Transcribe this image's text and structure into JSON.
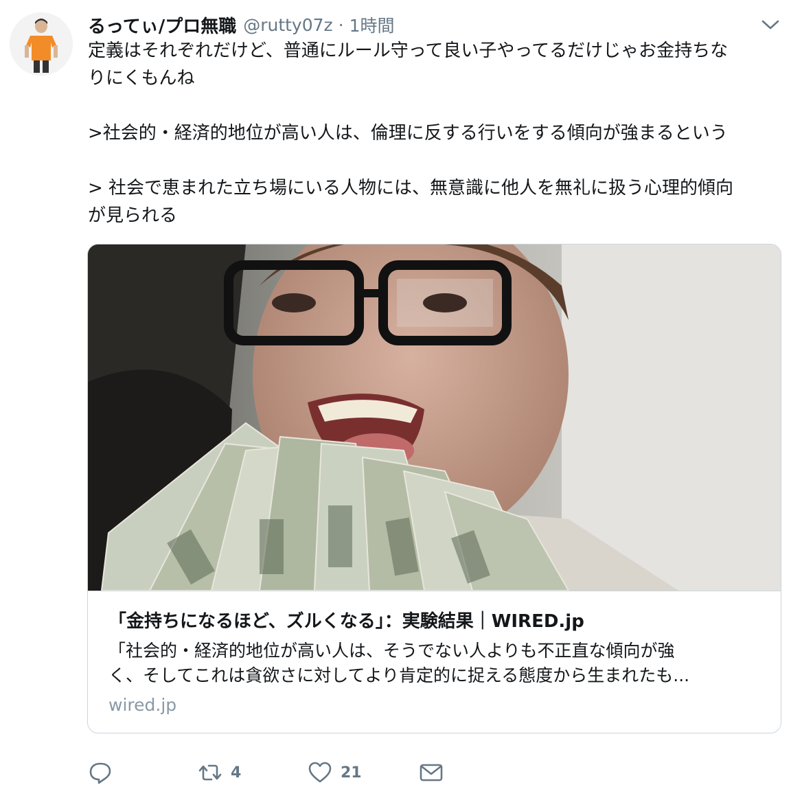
{
  "tweet": {
    "display_name": "るってぃ/プロ無職",
    "handle": "@rutty07z",
    "separator": "·",
    "time": "1時間",
    "lines": [
      "定義はそれぞれだけど、普通にルール守って良い子やってるだけじゃお金持ちな",
      "りにくもんね",
      "",
      ">社会的・経済的地位が高い人は、倫理に反する行いをする傾向が強まるという",
      "",
      "> 社会で恵まれた立ち場にいる人物には、無意識に他人を無礼に扱う心理的傾向",
      "が見られる"
    ]
  },
  "card": {
    "title": "「金持ちになるほど、ズルくなる」：実験結果｜WIRED.jp",
    "description_line1": "「社会的・経済的地位が高い人は、そうでない人よりも不正直な傾向が強",
    "description_line2": "く、そしてこれは貪欲さに対してより肯定的に捉える態度から生まれたも...",
    "domain": "wired.jp"
  },
  "actions": {
    "reply_icon": "reply-icon",
    "retweet_icon": "retweet-icon",
    "retweet_count": "4",
    "like_icon": "heart-icon",
    "like_count": "21",
    "dm_icon": "envelope-icon"
  },
  "colors": {
    "text": "#14171a",
    "secondary": "#657786",
    "border": "#ccd6dd",
    "domain": "#8899a6"
  }
}
